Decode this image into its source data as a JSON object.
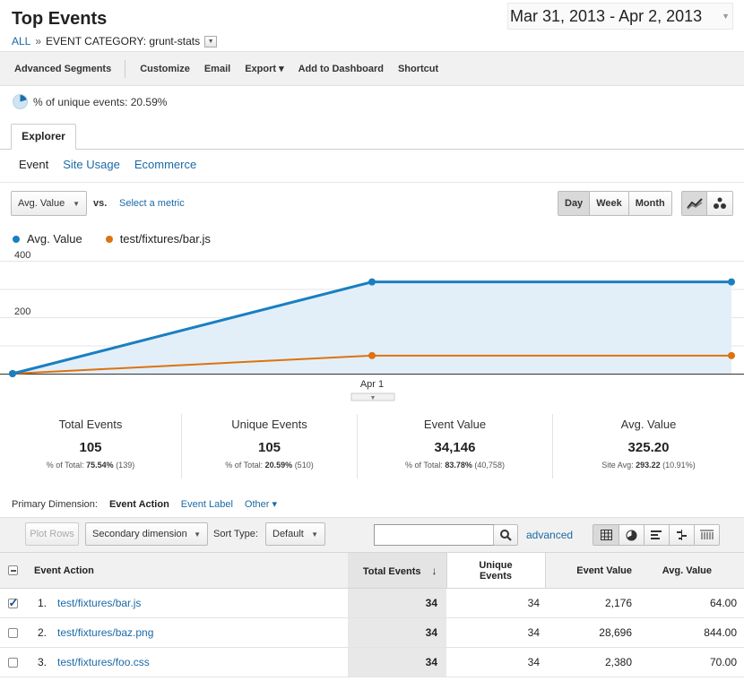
{
  "header": {
    "title": "Top Events",
    "breadcrumb": {
      "all": "ALL",
      "sep": "»",
      "current": "EVENT CATEGORY: grunt-stats"
    },
    "date_range": "Mar 31, 2013 - Apr 2, 2013"
  },
  "toolbar": [
    "Advanced Segments",
    "Customize",
    "Email",
    "Export ▾",
    "Add to Dashboard",
    "Shortcut"
  ],
  "pct_summary": "% of unique events: 20.59%",
  "tabs": {
    "explorer": "Explorer",
    "sub": [
      "Event",
      "Site Usage",
      "Ecommerce"
    ]
  },
  "chart_controls": {
    "metric_select": "Avg. Value",
    "vs": "vs.",
    "select_metric": "Select a metric",
    "periods": [
      "Day",
      "Week",
      "Month"
    ]
  },
  "colors": {
    "series1": "#1a7fc1",
    "series2": "#dd7211",
    "link": "#1a6aa7"
  },
  "chart_data": {
    "type": "line",
    "x": [
      "Mar 31",
      "Apr 1",
      "Apr 2"
    ],
    "x_tick_labels": [
      "Apr 1"
    ],
    "y_ticks": [
      400,
      200
    ],
    "ylim": [
      0,
      400
    ],
    "series": [
      {
        "name": "Avg. Value",
        "values": [
          0,
          325,
          325
        ]
      },
      {
        "name": "test/fixtures/bar.js",
        "values": [
          0,
          64,
          64
        ]
      }
    ],
    "grid": true,
    "legend": "top-left"
  },
  "metrics": [
    {
      "label": "Total Events",
      "value": "105",
      "sub_prefix": "% of Total: ",
      "sub_bold": "75.54%",
      "sub_rest": " (139)"
    },
    {
      "label": "Unique Events",
      "value": "105",
      "sub_prefix": "% of Total: ",
      "sub_bold": "20.59%",
      "sub_rest": " (510)"
    },
    {
      "label": "Event Value",
      "value": "34,146",
      "sub_prefix": "% of Total: ",
      "sub_bold": "83.78%",
      "sub_rest": " (40,758)"
    },
    {
      "label": "Avg. Value",
      "value": "325.20",
      "sub_prefix": "Site Avg: ",
      "sub_bold": "293.22",
      "sub_rest": " (10.91%)"
    }
  ],
  "primary_dimension": {
    "label": "Primary Dimension:",
    "current": "Event Action",
    "alt": "Event Label",
    "other": "Other ▾"
  },
  "table_tools": {
    "plot_rows": "Plot Rows",
    "secondary": "Secondary dimension",
    "sort_label": "Sort Type:",
    "sort_value": "Default",
    "search_placeholder": "",
    "advanced": "advanced"
  },
  "table": {
    "headers": [
      "Event Action",
      "Total Events",
      "Unique Events",
      "Event Value",
      "Avg. Value"
    ],
    "rows": [
      {
        "idx": "1.",
        "name": "test/fixtures/bar.js",
        "total": "34",
        "unique": "34",
        "value": "2,176",
        "avg": "64.00",
        "checked": true
      },
      {
        "idx": "2.",
        "name": "test/fixtures/baz.png",
        "total": "34",
        "unique": "34",
        "value": "28,696",
        "avg": "844.00",
        "checked": false
      },
      {
        "idx": "3.",
        "name": "test/fixtures/foo.css",
        "total": "34",
        "unique": "34",
        "value": "2,380",
        "avg": "70.00",
        "checked": false
      }
    ]
  }
}
